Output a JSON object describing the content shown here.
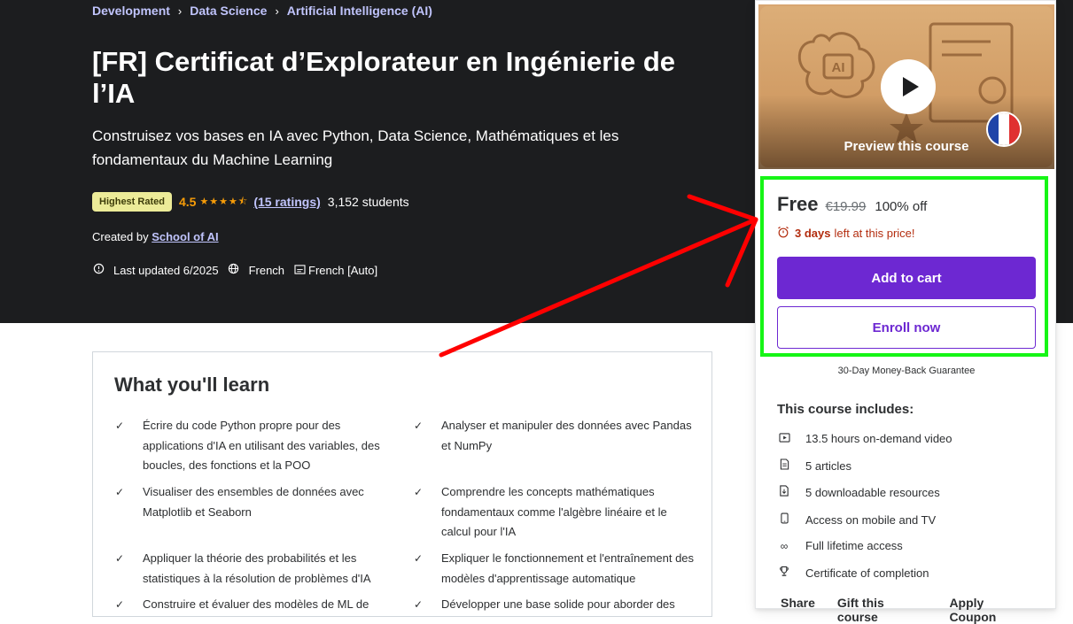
{
  "breadcrumb": [
    "Development",
    "Data Science",
    "Artificial Intelligence (AI)"
  ],
  "course": {
    "title": "[FR] Certificat d’Explorateur en Ingénierie de l’IA",
    "subtitle": "Construisez vos bases en IA avec Python, Data Science, Mathématiques et les fondamentaux du Machine Learning",
    "badge": "Highest Rated",
    "rating": "4.5",
    "stars": "★★★★⯪",
    "ratings_link": "(15 ratings)",
    "students": "3,152 students",
    "created_by_prefix": "Created by",
    "author": "School of AI",
    "last_updated": "Last updated 6/2025",
    "language": "French",
    "captions": "French [Auto]"
  },
  "learn": {
    "heading": "What you'll learn",
    "items": [
      "Écrire du code Python propre pour des applications d'IA en utilisant des variables, des boucles, des fonctions et la POO",
      "Analyser et manipuler des données avec Pandas et NumPy",
      "Visualiser des ensembles de données avec Matplotlib et Seaborn",
      "Comprendre les concepts mathématiques fondamentaux comme l'algèbre linéaire et le calcul pour l'IA",
      "Appliquer la théorie des probabilités et les statistiques à la résolution de problèmes d'IA",
      "Expliquer le fonctionnement et l'entraînement des modèles d'apprentissage automatique",
      "Construire et évaluer des modèles de ML de",
      "Développer une base solide pour aborder des"
    ]
  },
  "sidebar": {
    "preview_label": "Preview this course",
    "price": "Free",
    "old_price": "€19.99",
    "discount": "100% off",
    "timer_bold": "3 days",
    "timer_rest": "left at this price!",
    "add_to_cart": "Add to cart",
    "enroll_now": "Enroll now",
    "guarantee": "30-Day Money-Back Guarantee",
    "includes_title": "This course includes:",
    "includes": [
      {
        "icon": "video-icon",
        "label": "13.5 hours on-demand video"
      },
      {
        "icon": "article-icon",
        "label": "5 articles"
      },
      {
        "icon": "download-icon",
        "label": "5 downloadable resources"
      },
      {
        "icon": "mobile-icon",
        "label": "Access on mobile and TV"
      },
      {
        "icon": "infinity-icon",
        "label": "Full lifetime access"
      },
      {
        "icon": "trophy-icon",
        "label": "Certificate of completion"
      }
    ],
    "footer_links": [
      "Share",
      "Gift this course",
      "Apply Coupon"
    ]
  },
  "colors": {
    "hero_bg": "#1c1d1f",
    "accent_purple": "#6d28d2",
    "link_lavender": "#c0c4fc",
    "star_orange": "#f69c08",
    "annotation_green": "#16f516",
    "annotation_red": "#ff0000"
  }
}
